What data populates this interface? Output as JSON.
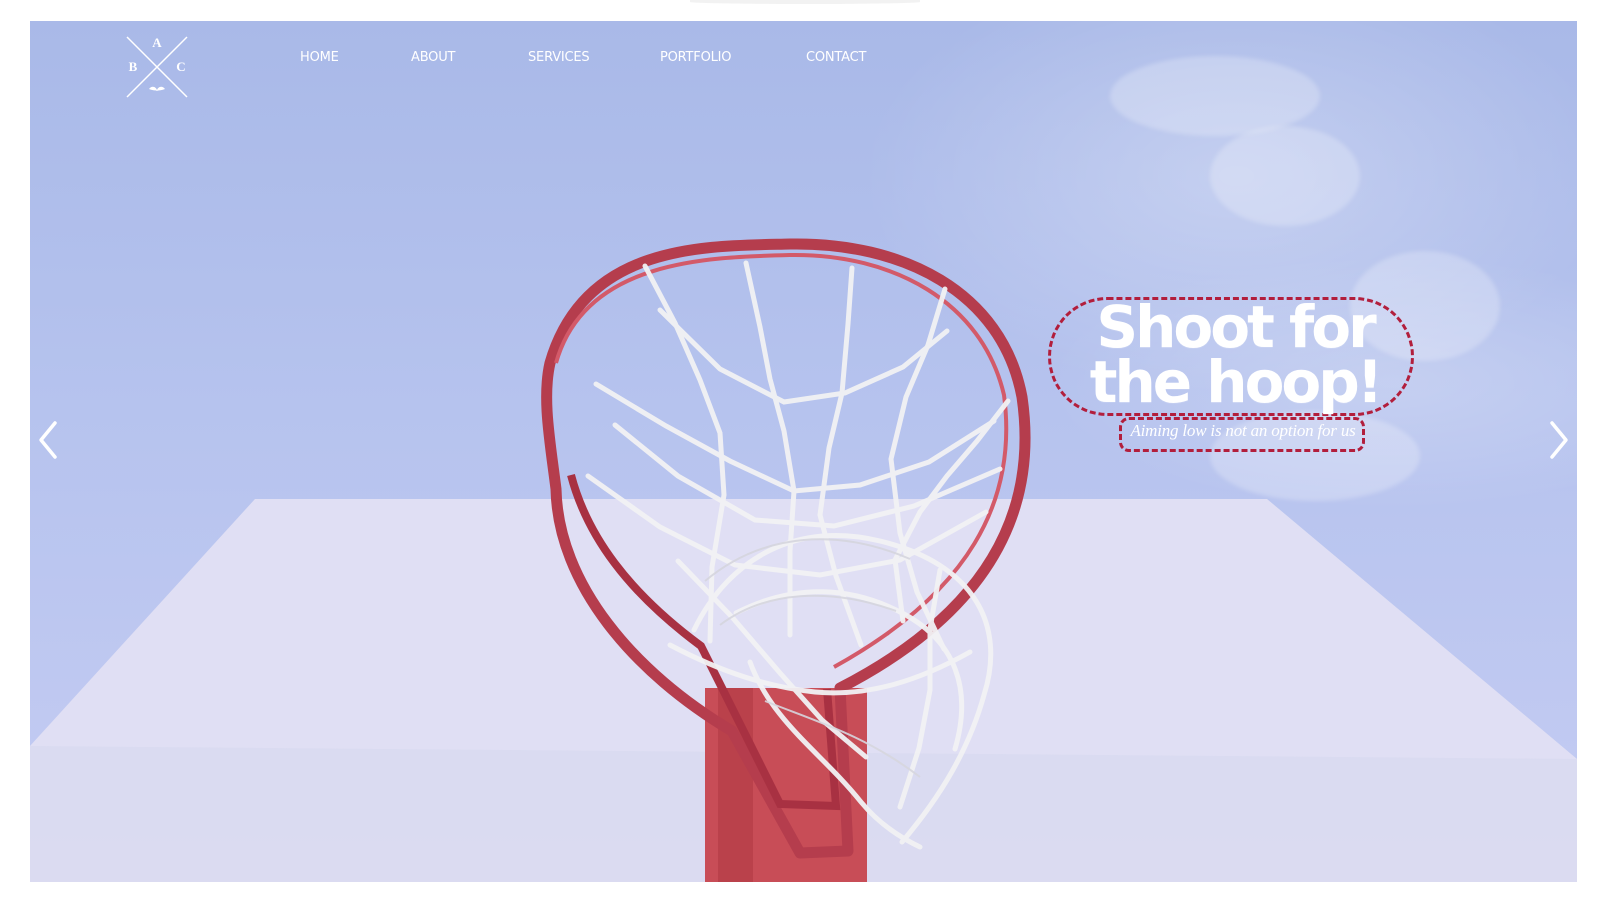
{
  "brand": {
    "logo_letters": [
      "A",
      "B",
      "C"
    ],
    "logo_icon": "mustache-cross-monogram"
  },
  "navigation": {
    "items": [
      {
        "label": "HOME"
      },
      {
        "label": "ABOUT"
      },
      {
        "label": "SERVICES"
      },
      {
        "label": "PORTFOLIO"
      },
      {
        "label": "CONTACT"
      }
    ]
  },
  "hero": {
    "headline": "Shoot for the hoop!",
    "tagline": "Aiming low is not an option for us",
    "image_icon": "basketball-hoop-image",
    "colors": {
      "accent": "#b21e3c",
      "sky": "#b6c3ee",
      "text": "#ffffff"
    }
  },
  "controls": {
    "previous_icon": "chevron-left-icon",
    "next_icon": "chevron-right-icon"
  }
}
